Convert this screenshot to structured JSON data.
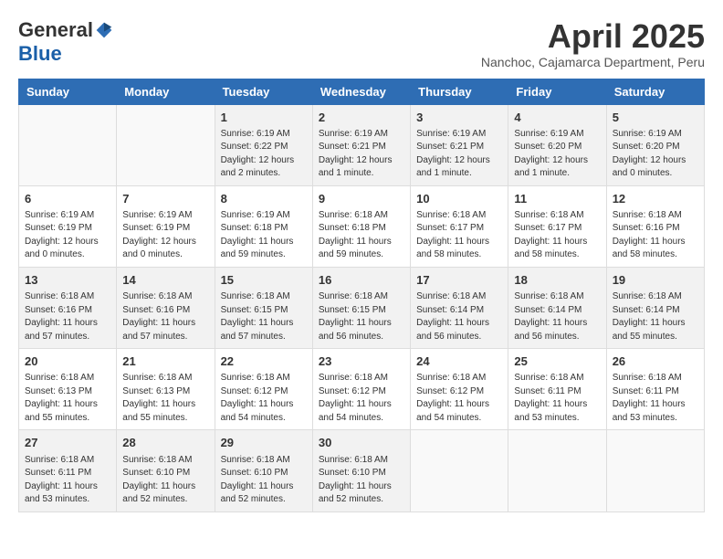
{
  "header": {
    "logo_general": "General",
    "logo_blue": "Blue",
    "title": "April 2025",
    "location": "Nanchoc, Cajamarca Department, Peru"
  },
  "weekdays": [
    "Sunday",
    "Monday",
    "Tuesday",
    "Wednesday",
    "Thursday",
    "Friday",
    "Saturday"
  ],
  "weeks": [
    [
      {
        "day": "",
        "info": ""
      },
      {
        "day": "",
        "info": ""
      },
      {
        "day": "1",
        "info": "Sunrise: 6:19 AM\nSunset: 6:22 PM\nDaylight: 12 hours and 2 minutes."
      },
      {
        "day": "2",
        "info": "Sunrise: 6:19 AM\nSunset: 6:21 PM\nDaylight: 12 hours and 1 minute."
      },
      {
        "day": "3",
        "info": "Sunrise: 6:19 AM\nSunset: 6:21 PM\nDaylight: 12 hours and 1 minute."
      },
      {
        "day": "4",
        "info": "Sunrise: 6:19 AM\nSunset: 6:20 PM\nDaylight: 12 hours and 1 minute."
      },
      {
        "day": "5",
        "info": "Sunrise: 6:19 AM\nSunset: 6:20 PM\nDaylight: 12 hours and 0 minutes."
      }
    ],
    [
      {
        "day": "6",
        "info": "Sunrise: 6:19 AM\nSunset: 6:19 PM\nDaylight: 12 hours and 0 minutes."
      },
      {
        "day": "7",
        "info": "Sunrise: 6:19 AM\nSunset: 6:19 PM\nDaylight: 12 hours and 0 minutes."
      },
      {
        "day": "8",
        "info": "Sunrise: 6:19 AM\nSunset: 6:18 PM\nDaylight: 11 hours and 59 minutes."
      },
      {
        "day": "9",
        "info": "Sunrise: 6:18 AM\nSunset: 6:18 PM\nDaylight: 11 hours and 59 minutes."
      },
      {
        "day": "10",
        "info": "Sunrise: 6:18 AM\nSunset: 6:17 PM\nDaylight: 11 hours and 58 minutes."
      },
      {
        "day": "11",
        "info": "Sunrise: 6:18 AM\nSunset: 6:17 PM\nDaylight: 11 hours and 58 minutes."
      },
      {
        "day": "12",
        "info": "Sunrise: 6:18 AM\nSunset: 6:16 PM\nDaylight: 11 hours and 58 minutes."
      }
    ],
    [
      {
        "day": "13",
        "info": "Sunrise: 6:18 AM\nSunset: 6:16 PM\nDaylight: 11 hours and 57 minutes."
      },
      {
        "day": "14",
        "info": "Sunrise: 6:18 AM\nSunset: 6:16 PM\nDaylight: 11 hours and 57 minutes."
      },
      {
        "day": "15",
        "info": "Sunrise: 6:18 AM\nSunset: 6:15 PM\nDaylight: 11 hours and 57 minutes."
      },
      {
        "day": "16",
        "info": "Sunrise: 6:18 AM\nSunset: 6:15 PM\nDaylight: 11 hours and 56 minutes."
      },
      {
        "day": "17",
        "info": "Sunrise: 6:18 AM\nSunset: 6:14 PM\nDaylight: 11 hours and 56 minutes."
      },
      {
        "day": "18",
        "info": "Sunrise: 6:18 AM\nSunset: 6:14 PM\nDaylight: 11 hours and 56 minutes."
      },
      {
        "day": "19",
        "info": "Sunrise: 6:18 AM\nSunset: 6:14 PM\nDaylight: 11 hours and 55 minutes."
      }
    ],
    [
      {
        "day": "20",
        "info": "Sunrise: 6:18 AM\nSunset: 6:13 PM\nDaylight: 11 hours and 55 minutes."
      },
      {
        "day": "21",
        "info": "Sunrise: 6:18 AM\nSunset: 6:13 PM\nDaylight: 11 hours and 55 minutes."
      },
      {
        "day": "22",
        "info": "Sunrise: 6:18 AM\nSunset: 6:12 PM\nDaylight: 11 hours and 54 minutes."
      },
      {
        "day": "23",
        "info": "Sunrise: 6:18 AM\nSunset: 6:12 PM\nDaylight: 11 hours and 54 minutes."
      },
      {
        "day": "24",
        "info": "Sunrise: 6:18 AM\nSunset: 6:12 PM\nDaylight: 11 hours and 54 minutes."
      },
      {
        "day": "25",
        "info": "Sunrise: 6:18 AM\nSunset: 6:11 PM\nDaylight: 11 hours and 53 minutes."
      },
      {
        "day": "26",
        "info": "Sunrise: 6:18 AM\nSunset: 6:11 PM\nDaylight: 11 hours and 53 minutes."
      }
    ],
    [
      {
        "day": "27",
        "info": "Sunrise: 6:18 AM\nSunset: 6:11 PM\nDaylight: 11 hours and 53 minutes."
      },
      {
        "day": "28",
        "info": "Sunrise: 6:18 AM\nSunset: 6:10 PM\nDaylight: 11 hours and 52 minutes."
      },
      {
        "day": "29",
        "info": "Sunrise: 6:18 AM\nSunset: 6:10 PM\nDaylight: 11 hours and 52 minutes."
      },
      {
        "day": "30",
        "info": "Sunrise: 6:18 AM\nSunset: 6:10 PM\nDaylight: 11 hours and 52 minutes."
      },
      {
        "day": "",
        "info": ""
      },
      {
        "day": "",
        "info": ""
      },
      {
        "day": "",
        "info": ""
      }
    ]
  ]
}
